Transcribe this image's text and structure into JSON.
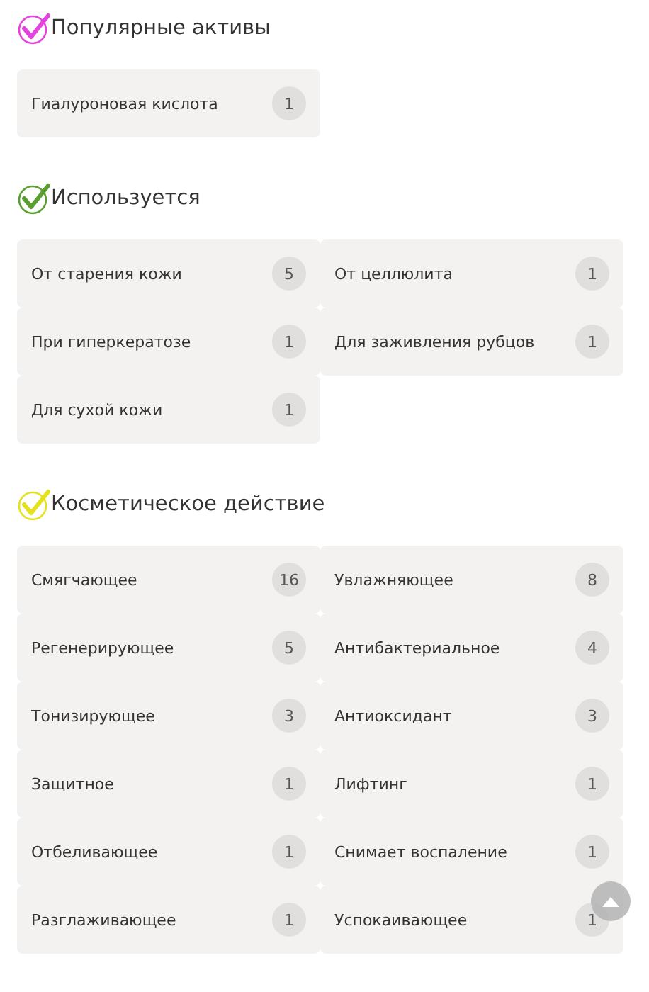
{
  "sections": [
    {
      "title": "Популярные активы",
      "color": "#e543e0",
      "items": [
        {
          "label": "Гиалуроновая кислота",
          "count": "1"
        }
      ]
    },
    {
      "title": "Используется",
      "color": "#5a9e2f",
      "items": [
        {
          "label": "От старения кожи",
          "count": "5"
        },
        {
          "label": "От целлюлита",
          "count": "1"
        },
        {
          "label": "При гиперкератозе",
          "count": "1"
        },
        {
          "label": "Для заживления рубцов",
          "count": "1"
        },
        {
          "label": "Для сухой кожи",
          "count": "1"
        }
      ]
    },
    {
      "title": "Косметическое действие",
      "color": "#e3e21c",
      "items": [
        {
          "label": "Смягчающее",
          "count": "16"
        },
        {
          "label": "Увлажняющее",
          "count": "8"
        },
        {
          "label": "Регенерирующее",
          "count": "5"
        },
        {
          "label": "Антибактериальное",
          "count": "4"
        },
        {
          "label": "Тонизирующее",
          "count": "3"
        },
        {
          "label": "Антиоксидант",
          "count": "3"
        },
        {
          "label": "Защитное",
          "count": "1"
        },
        {
          "label": "Лифтинг",
          "count": "1"
        },
        {
          "label": "Отбеливающее",
          "count": "1"
        },
        {
          "label": "Снимает воспаление",
          "count": "1"
        },
        {
          "label": "Разглаживающее",
          "count": "1"
        },
        {
          "label": "Успокаивающее",
          "count": "1"
        }
      ]
    }
  ]
}
